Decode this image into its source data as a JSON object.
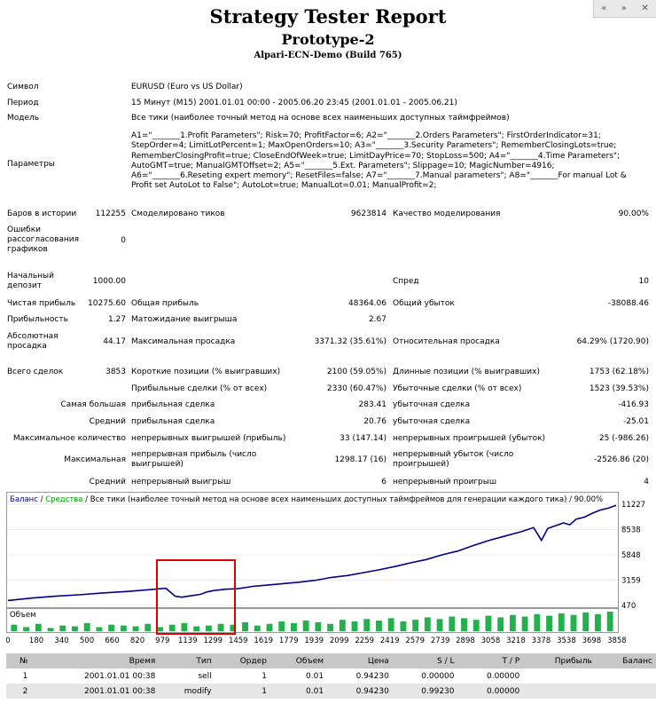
{
  "report": {
    "title": "Strategy Tester Report",
    "expert": "Prototype-2",
    "server": "Alpari-ECN-Demo (Build 765)"
  },
  "nav": {
    "prev": "«",
    "next": "»",
    "close": "✕"
  },
  "labels": {
    "symbol": "Символ",
    "period": "Период",
    "model": "Модель",
    "params": "Параметры",
    "bars": "Баров в истории",
    "mismatch": "Ошибки рассогласования графиков",
    "deposit": "Начальный депозит",
    "net_profit": "Чистая прибыль",
    "profit_factor": "Прибыльность",
    "abs_drawdown": "Абсолютная просадка",
    "total_trades": "Всего сделок",
    "ticks": "Смоделировано тиков",
    "quality": "Качество моделирования",
    "spread": "Спред",
    "gross_profit": "Общая прибыль",
    "gross_loss": "Общий убыток",
    "expected_payoff": "Матожидание выигрыша",
    "max_drawdown": "Максимальная просадка",
    "rel_drawdown": "Относительная просадка",
    "short_pos": "Короткие позиции (% выигравших)",
    "long_pos": "Длинные позиции (% выигравших)",
    "profit_trades": "Прибыльные сделки (% от всех)",
    "loss_trades": "Убыточные сделки (% от всех)",
    "largest": "Самая большая",
    "average": "Средний",
    "max_count": "Максимальное количество",
    "maximal": "Максимальная",
    "average2": "Средний",
    "prof_trade": "прибыльная сделка",
    "loss_trade": "убыточная сделка",
    "prof_trade2": "прибыльная сделка",
    "loss_trade2": "убыточная сделка",
    "cons_wins": "непрерывных выигрышей (прибыль)",
    "cons_losses": "непрерывных проигрышей (убыток)",
    "cons_profit": "непрерывная прибыль (число выигрышей)",
    "cons_loss": "непрерывный убыток (число проигрышей)",
    "avg_wins": "непрерывный выигрыш",
    "avg_losses": "непрерывный проигрыш"
  },
  "values": {
    "symbol": "EURUSD (Euro vs US Dollar)",
    "period": "15 Минут (M15) 2001.01.01 00:00 - 2005.06.20 23:45 (2001.01.01 - 2005.06.21)",
    "model": "Все тики (наиболее точный метод на основе всех наименьших доступных таймфреймов)",
    "params": "A1=\"_______1.Profit Parameters\"; Risk=70; ProfitFactor=6; A2=\"_______2.Orders Parameters\"; FirstOrderIndicator=31; StepOrder=4; LimitLotPercent=1; MaxOpenOrders=10; A3=\"_______3.Security Parameters\"; RememberClosingLots=true; RememberClosingProfit=true; CloseEndOfWeek=true; LimitDayPrice=70; StopLoss=500; A4=\"_______4.Time Parameters\"; AutoGMT=true; ManualGMTOffset=2; A5=\"_______5.Ext. Parameters\"; Slippage=10; MagicNumber=4916; A6=\"_______6.Reseting expert memory\"; ResetFiles=false; A7=\"_______7.Manual parameters\"; A8=\"_______For manual Lot & Profit set AutoLot to False\"; AutoLot=true; ManualLot=0.01; ManualProfit=2;",
    "bars": "112255",
    "mismatch": "0",
    "deposit": "1000.00",
    "net_profit": "10275.60",
    "profit_factor": "1.27",
    "abs_drawdown": "44.17",
    "total_trades": "3853",
    "ticks": "9623814",
    "quality": "90.00%",
    "spread": "10",
    "gross_profit": "48364.06",
    "gross_loss": "-38088.46",
    "expected_payoff": "2.67",
    "max_drawdown": "3371.32 (35.61%)",
    "rel_drawdown": "64.29% (1720.90)",
    "short_pos": "2100 (59.05%)",
    "long_pos": "1753 (62.18%)",
    "profit_trades": "2330 (60.47%)",
    "loss_trades": "1523 (39.53%)",
    "largest_profit": "283.41",
    "largest_loss": "-416.93",
    "average_profit": "20.76",
    "average_loss": "-25.01",
    "cons_wins": "33 (147.14)",
    "cons_losses": "25 (-986.26)",
    "cons_profit": "1298.17 (16)",
    "cons_loss": "-2526.86 (20)",
    "avg_wins": "6",
    "avg_losses": "4"
  },
  "chart_data": {
    "type": "line",
    "legend": {
      "balance": "Баланс",
      "sep1": " / ",
      "equity": "Средства",
      "rest": " / Все тики (наиболее точный метод на основе всех наименьших доступных таймфреймов для генерации каждого тика) / 90.00%"
    },
    "volume_label": "Объем",
    "y_ticks": [
      "11227",
      "8538",
      "5848",
      "3159",
      "470"
    ],
    "x_ticks": [
      "0",
      "180",
      "340",
      "500",
      "660",
      "820",
      "979",
      "1139",
      "1299",
      "1459",
      "1619",
      "1779",
      "1939",
      "2099",
      "2259",
      "2419",
      "2579",
      "2739",
      "2898",
      "3058",
      "3218",
      "3378",
      "3538",
      "3698",
      "3858"
    ],
    "ylim": [
      470,
      11227
    ],
    "xlim": [
      0,
      3853
    ],
    "series": [
      {
        "name": "Баланс",
        "x": [
          0,
          150,
          300,
          450,
          600,
          750,
          900,
          1000,
          1060,
          1100,
          1160,
          1220,
          1260,
          1300,
          1380,
          1460,
          1550,
          1650,
          1750,
          1850,
          1950,
          2050,
          2150,
          2250,
          2350,
          2450,
          2550,
          2650,
          2750,
          2850,
          2950,
          3050,
          3150,
          3250,
          3330,
          3380,
          3420,
          3470,
          3520,
          3560,
          3600,
          3650,
          3700,
          3750,
          3800,
          3853
        ],
        "values": [
          1000,
          1250,
          1450,
          1600,
          1800,
          1950,
          2150,
          2300,
          1450,
          1350,
          1500,
          1650,
          1900,
          2050,
          2200,
          2250,
          2500,
          2650,
          2800,
          2950,
          3150,
          3450,
          3650,
          3950,
          4250,
          4600,
          5000,
          5350,
          5850,
          6250,
          6850,
          7400,
          7850,
          8300,
          8750,
          7400,
          8650,
          8950,
          9250,
          9050,
          9650,
          9850,
          10250,
          10600,
          10800,
          11100
        ]
      }
    ],
    "highlight_label": "",
    "volume": [
      8,
      5,
      9,
      4,
      7,
      6,
      10,
      5,
      8,
      7,
      6,
      9,
      5,
      8,
      10,
      6,
      7,
      9,
      8,
      11,
      7,
      9,
      12,
      10,
      13,
      11,
      9,
      14,
      12,
      15,
      13,
      16,
      12,
      14,
      17,
      15,
      18,
      16,
      14,
      19,
      17,
      20,
      18,
      21,
      19,
      22,
      20,
      23,
      21,
      24
    ]
  },
  "trades": {
    "headers": [
      "№",
      "Время",
      "Тип",
      "Ордер",
      "Объем",
      "Цена",
      "S / L",
      "T / P",
      "Прибыль",
      "Баланс"
    ],
    "rows": [
      [
        "1",
        "2001.01.01 00:38",
        "sell",
        "1",
        "0.01",
        "0.94230",
        "0.00000",
        "0.00000",
        "",
        ""
      ],
      [
        "2",
        "2001.01.01 00:38",
        "modify",
        "1",
        "0.01",
        "0.94230",
        "0.99230",
        "0.00000",
        "",
        ""
      ]
    ]
  },
  "colors": {
    "balance": "#00008b",
    "equity": "#00a000",
    "volume": "#22b14c",
    "highlight": "#e00000",
    "grid": "#c8c8c8"
  }
}
